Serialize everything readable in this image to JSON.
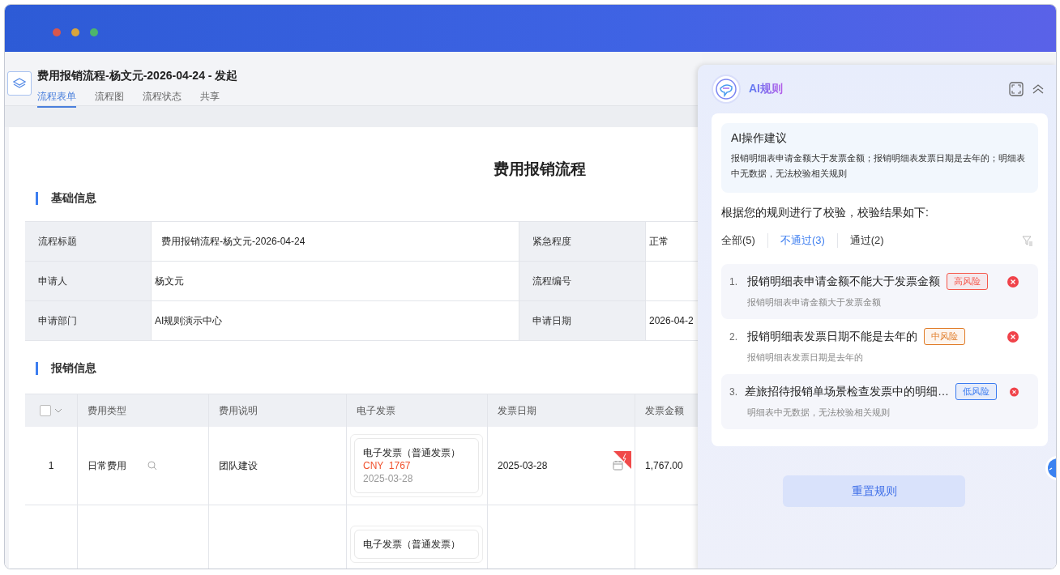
{
  "page": {
    "title": "费用报销流程-杨文元-2026-04-24 - 发起",
    "tabs": [
      {
        "label": "流程表单",
        "selected": true
      },
      {
        "label": "流程图",
        "selected": false
      },
      {
        "label": "流程状态",
        "selected": false
      },
      {
        "label": "共享",
        "selected": false
      }
    ]
  },
  "form": {
    "title": "费用报销流程",
    "basic_section": {
      "heading": "基础信息",
      "rows": [
        [
          {
            "label": "流程标题",
            "value": "费用报销流程-杨文元-2026-04-24"
          },
          {
            "label": "紧急程度",
            "value": "正常"
          }
        ],
        [
          {
            "label": "申请人",
            "value": "杨文元"
          },
          {
            "label": "流程编号"
          }
        ],
        [
          {
            "label": "申请部门",
            "value": "AI规则演示中心"
          },
          {
            "label": "申请日期",
            "value": "2026-04-2"
          }
        ]
      ]
    },
    "expense_section": {
      "heading": "报销信息",
      "select_all_checked": false,
      "columns": [
        "费用类型",
        "费用说明",
        "电子发票",
        "发票日期",
        "发票金额"
      ],
      "rows": [
        {
          "index": "1",
          "type": "日常费用",
          "description": "团队建设",
          "invoice": {
            "title": "电子发票（普通发票）",
            "amount": "CNY  1767",
            "date": "2025-03-28"
          },
          "invoice_date": "2025-03-28",
          "invoice_amount": "1,767.00"
        },
        {
          "invoice": {
            "title": "电子发票（普通发票）"
          }
        }
      ]
    }
  },
  "ai_panel": {
    "title": "AI规则",
    "suggestion": {
      "title": "AI操作建议",
      "text": "报销明细表申请金额大于发票金额；报销明细表发票日期是去年的；明细表中无数据，无法校验相关规则"
    },
    "summary": "根据您的规则进行了校验，校验结果如下:",
    "filters": [
      {
        "label": "全部(5)",
        "selected": false
      },
      {
        "label": "不通过(3)",
        "selected": true
      },
      {
        "label": "通过(2)",
        "selected": false
      }
    ],
    "results": [
      {
        "number": "1.",
        "title": "报销明细表申请金额不能大于发票金额",
        "risk": "高风险",
        "color": "#f5574b",
        "detail": "报销明细表申请金额大于发票金额"
      },
      {
        "number": "2.",
        "title": "报销明细表发票日期不能是去年的",
        "risk": "中风险",
        "color": "#e07b26",
        "detail": "报销明细表发票日期是去年的"
      },
      {
        "number": "3.",
        "title": "差旅招待报销单场景检查发票中的明细…",
        "risk": "低风险",
        "color": "#3b7bf0",
        "detail": "明细表中无数据，无法校验相关规则"
      }
    ],
    "reset_button": "重置规则"
  }
}
